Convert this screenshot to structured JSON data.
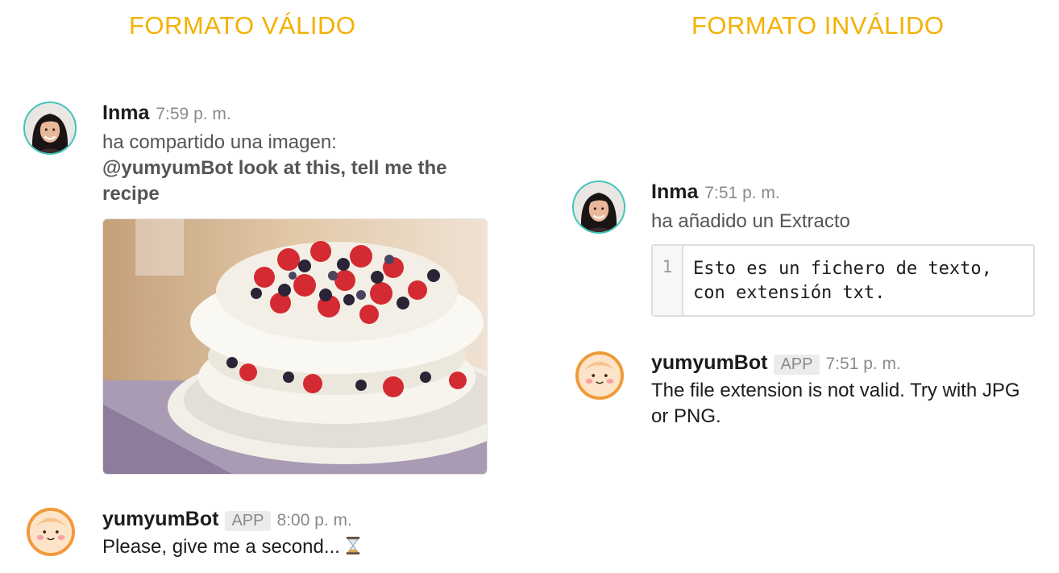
{
  "headings": {
    "valid": "FORMATO VÁLIDO",
    "invalid": "FORMATO INVÁLIDO"
  },
  "left": {
    "message1": {
      "name": "Inma",
      "time": "7:59 p. m.",
      "action": "ha compartido una imagen:",
      "text": "@yumyumBot look at this, tell me the recipe"
    },
    "message2": {
      "name": "yumyumBot",
      "badge": "APP",
      "time": "8:00 p. m.",
      "text": "Please, give me a second..."
    }
  },
  "right": {
    "message1": {
      "name": "Inma",
      "time": "7:51 p. m.",
      "action": "ha añadido un Extracto",
      "snippet": {
        "line_number": "1",
        "code": "Esto es un fichero de texto, con extensión txt."
      }
    },
    "message2": {
      "name": "yumyumBot",
      "badge": "APP",
      "time": "7:51 p. m.",
      "text": "The file extension is not valid. Try with JPG or PNG."
    }
  },
  "icons": {
    "hourglass": "hourglass-icon"
  },
  "colors": {
    "heading": "#f3b100",
    "inma_ring": "#3ec5b9",
    "bot_ring": "#f09a3a"
  }
}
